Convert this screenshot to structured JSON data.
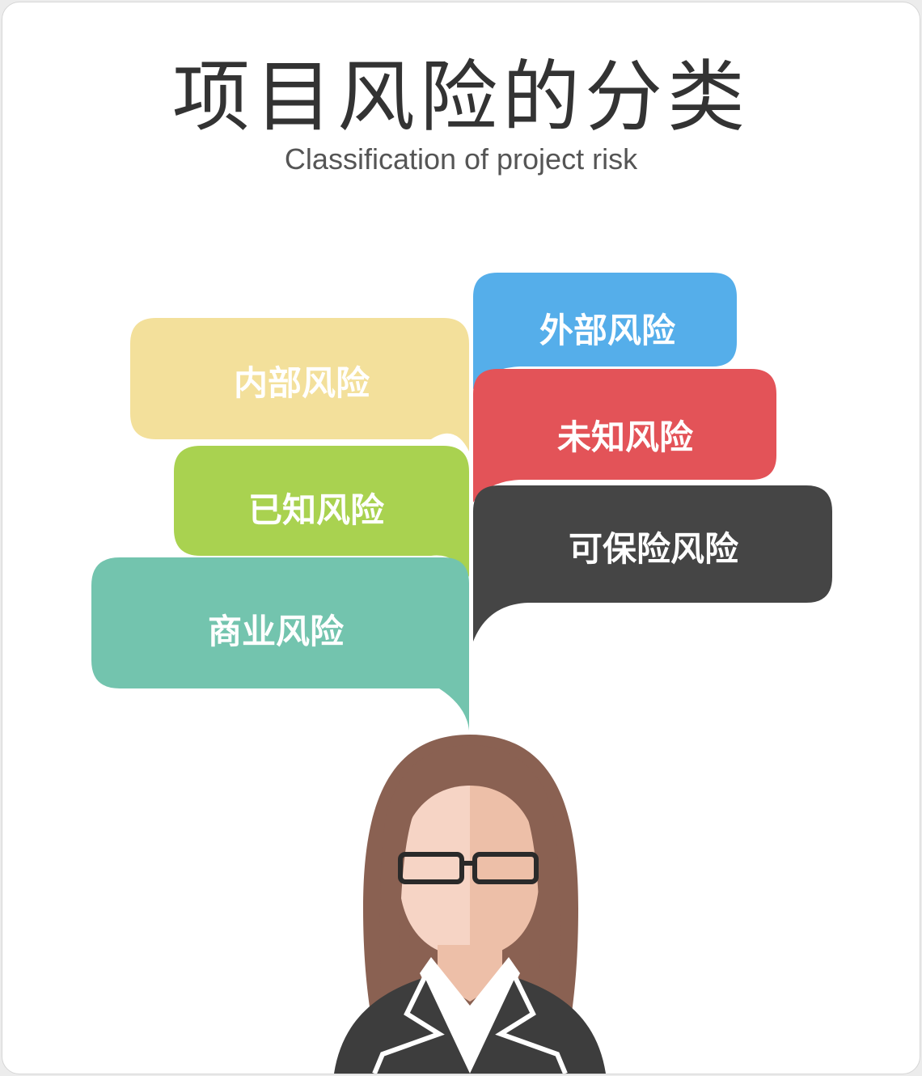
{
  "title": "项目风险的分类",
  "subtitle": "Classification of project risk",
  "bubbles": {
    "internal": {
      "label": "内部风险",
      "color": "#F3E09B",
      "text_color": "#FFFFFF"
    },
    "known": {
      "label": "已知风险",
      "color": "#A9D250",
      "text_color": "#FFFFFF"
    },
    "business": {
      "label": "商业风险",
      "color": "#73C4AE",
      "text_color": "#FFFFFF"
    },
    "external": {
      "label": "外部风险",
      "color": "#55AEEA",
      "text_color": "#FFFFFF"
    },
    "unknown": {
      "label": "未知风险",
      "color": "#E35358",
      "text_color": "#FFFFFF"
    },
    "insurable": {
      "label": "可保险风险",
      "color": "#454545",
      "text_color": "#FFFFFF"
    }
  },
  "illustration": {
    "figure": "woman-with-glasses",
    "hair_color": "#8A6152",
    "skin_light": "#F6D4C5",
    "skin_dark": "#EDBFA8",
    "suit_color": "#3D3D3D"
  }
}
